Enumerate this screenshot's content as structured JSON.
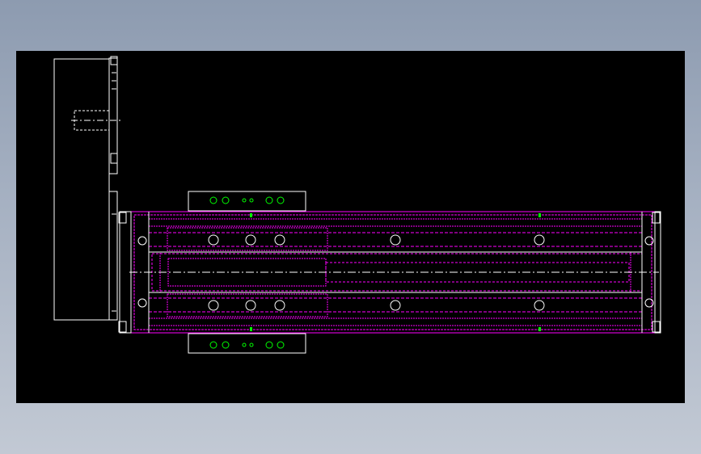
{
  "viewer": {
    "background_color": "#000000",
    "page_color": "#9aa6b8"
  },
  "drawing": {
    "colors": {
      "outline": "#ffffff",
      "rail": "#ff00ff",
      "hole": "#ffffff",
      "marker": "#00ff00",
      "centerline": "#ffffff"
    },
    "parts": {
      "motor_housing": "motor-housing",
      "base_rail": "base-rail",
      "slider_carriage": "slider-carriage",
      "end_cap_left": "end-cap-left",
      "end_cap_right": "end-cap-right"
    }
  }
}
